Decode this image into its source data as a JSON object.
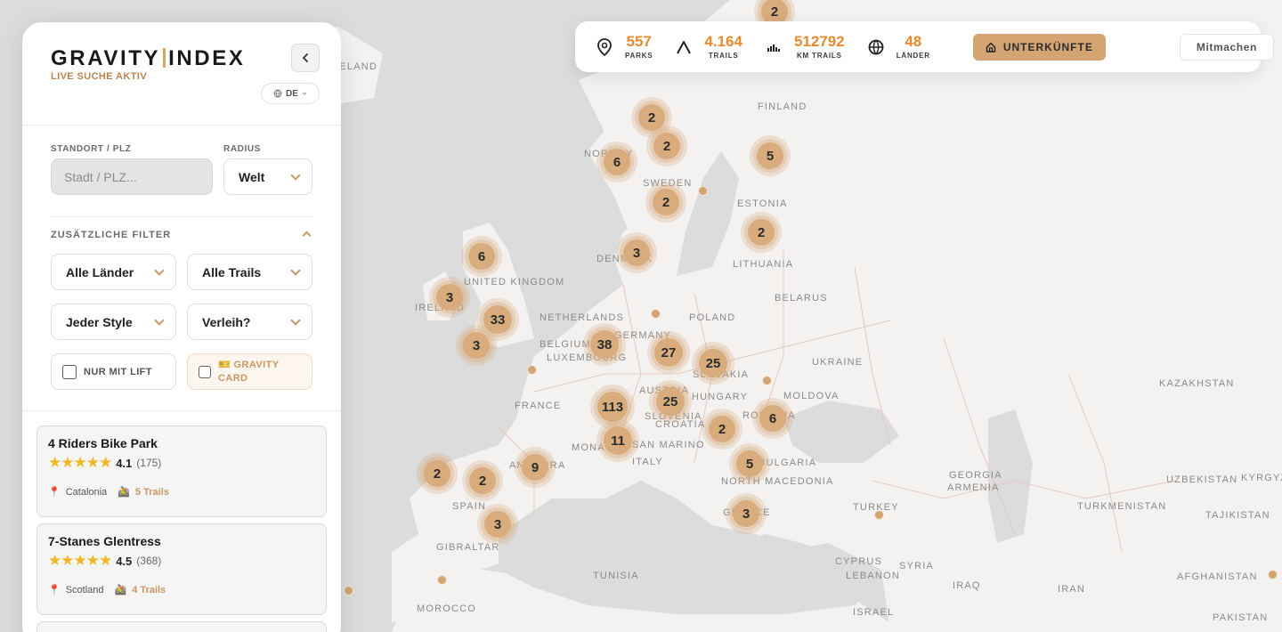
{
  "sidebar": {
    "logo_left": "GRAVITY",
    "logo_right": "INDEX",
    "live_status": "LIVE SUCHE AKTIV",
    "language": "DE",
    "location_label": "STANDORT / PLZ",
    "location_placeholder": "Stadt / PLZ...",
    "radius_label": "RADIUS",
    "radius_value": "Welt",
    "extra_filters_label": "ZUSÄTZLICHE FILTER",
    "filter_countries": "Alle Länder",
    "filter_trails": "Alle Trails",
    "filter_style": "Jeder Style",
    "filter_rental": "Verleih?",
    "lift_only_label": "NUR MIT LIFT",
    "gravity_card_label": "🎫 GRAVITY CARD"
  },
  "parks": [
    {
      "name": "4 Riders Bike Park",
      "stars": "★★★★★",
      "rating": "4.1",
      "reviews": "(175)",
      "region": "Catalonia",
      "trails": "5 Trails"
    },
    {
      "name": "7-Stanes Glentress",
      "stars": "★★★★★",
      "rating": "4.5",
      "reviews": "(368)",
      "region": "Scotland",
      "trails": "4 Trails"
    }
  ],
  "stats": {
    "parks_value": "557",
    "parks_label": "PARKS",
    "trails_value": "4.164",
    "trails_label": "TRAILS",
    "km_value": "512792",
    "km_label": "KM TRAILS",
    "countries_value": "48",
    "countries_label": "LÄNDER",
    "accommodation_label": "UNTERKÜNFTE",
    "join_label": "Mitmachen"
  },
  "map": {
    "accent": "#d9ac7d",
    "country_labels": [
      "FINLAND",
      "SWEDEN",
      "ESTONIA",
      "LITHUANIA",
      "DENMARK",
      "UNITED KINGDOM",
      "IRELAND",
      "NETHERLANDS",
      "BELGIUM",
      "LUXEMBOURG",
      "GERMANY",
      "POLAND",
      "BELARUS",
      "UKRAINE",
      "KAZAKHSTAN",
      "FRANCE",
      "AUSTRIA",
      "SLOVENIA",
      "CROATIA",
      "HUNGARY",
      "SLOVAKIA",
      "MOLDOVA",
      "ROMANIA",
      "BULGARIA",
      "NORTH MACEDONIA",
      "MONACO",
      "SAN MARINO",
      "ITALY",
      "ANDORRA",
      "SPAIN",
      "GIBRALTAR",
      "GEORGIA",
      "ARMENIA",
      "UZBEKISTAN",
      "KYRGYZ",
      "TURKMENISTAN",
      "TAJIKISTAN",
      "TURKEY",
      "CYPRUS",
      "SYRIA",
      "LEBANON",
      "IRAQ",
      "IRAN",
      "AFGHANISTAN",
      "PAKISTAN",
      "TUNISIA",
      "MOROCCO",
      "ISRAEL",
      "NORWAY",
      "ICELAND",
      "GREECE"
    ],
    "clusters": [
      "2",
      "2",
      "2",
      "6",
      "5",
      "2",
      "2",
      "3",
      "6",
      "3",
      "33",
      "3",
      "38",
      "27",
      "25",
      "113",
      "25",
      "11",
      "2",
      "6",
      "5",
      "3",
      "9",
      "2",
      "2",
      "3"
    ]
  }
}
